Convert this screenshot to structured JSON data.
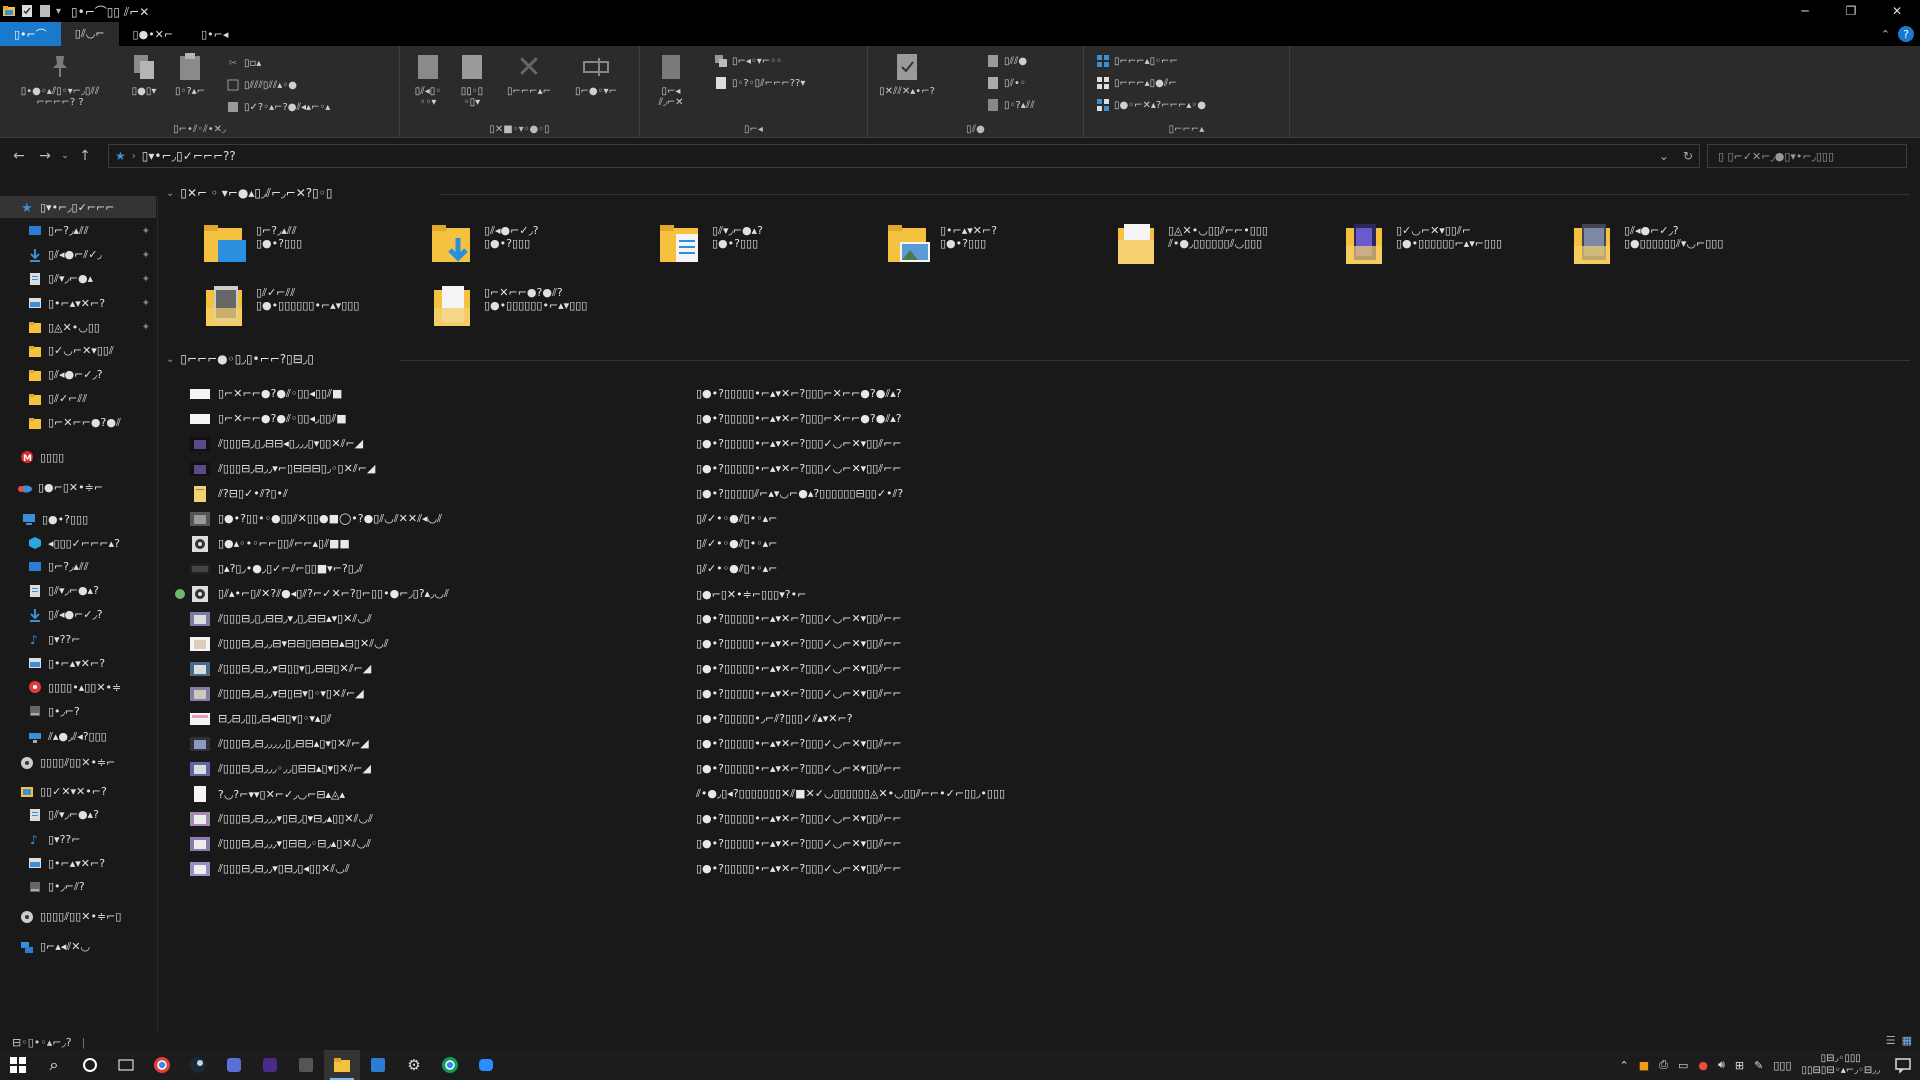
{
  "window": {
    "title": "▯•⌐⌒▯▯ ⫽⌐✕",
    "minimize": "─",
    "maximize": "❐",
    "close": "✕"
  },
  "ribbon_tabs": [
    "▯•⌐⌒",
    "▯⫽◡⌐",
    "▯●•✕⌐",
    "▯•⌐◂"
  ],
  "ribbon": {
    "clipboard": {
      "pin_label": "▯•●◦▴⫽▯◦▾⌐◞▯⫽⫽\n⌐⌐⌐⌐? ?",
      "copy_label": "▯●▯▾",
      "paste_label": "▯◦?▴⌐",
      "cut": "▯▫▴",
      "copy_path": "▯⫽⫽⫽▯⫽⫽▴◦●",
      "paste_shortcut": "▯✓?◦▴⌐?●⫽◂▴⌐◦▴",
      "group": "▯⌐•⫽◦⫽•✕◞"
    },
    "organize": {
      "move_to": "▯⫽◂▯◦\n◦◦▾",
      "copy_to": "▯▯◦▯\n◦▯▾",
      "delete": "▯⌐⌐⌐▴⌐",
      "rename": "▯⌐●◦▾⌐",
      "group": "▯✕■◦▾◦●◦▯"
    },
    "new": {
      "new_folder": "▯⌐◂\n⫽◞⌐✕",
      "new_item": "▯⌐◂◦▾⌐◦◦",
      "easy_access": "▯◦?◦▯⫽⌐⌐⌐??▾",
      "group": "▯⌐◂"
    },
    "open": {
      "properties": "▯✕⫽⫽✕▴•⌐?",
      "open": "▯⫽⫽●",
      "edit": "▯⫽•◦",
      "history": "▯◦?▴⫽⫽",
      "group": "▯⫽●"
    },
    "select": {
      "select_all": "▯⌐⌐⌐▴▯◦⌐⌐",
      "select_none": "▯⌐⌐⌐▴▯●⫽⌐",
      "invert": "▯●◦⌐✕▴?⌐⌐⌐▴◦●",
      "group": "▯⌐⌐⌐▴"
    }
  },
  "address": {
    "path": "▯▾•⌐◞▯✓⌐⌐⌐??",
    "search_placeholder": "▯ ▯⌐✓✕⌐◞●▯▾•⌐◞▯▯▯"
  },
  "sidebar": {
    "items": [
      {
        "label": "▯▾•⌐◞▯✓⌐⌐⌐",
        "icon": "star-icon",
        "pinned": false,
        "selected": true
      },
      {
        "label": "▯⌐?◞▴⫽⫽",
        "icon": "desktop-icon",
        "pinned": true
      },
      {
        "label": "▯⫽◂●⌐⫽✓◞",
        "icon": "download-icon",
        "pinned": true
      },
      {
        "label": "▯⫽▾◞⌐●▴",
        "icon": "document-icon",
        "pinned": true
      },
      {
        "label": "▯•⌐▴▾✕⌐?",
        "icon": "pictures-icon",
        "pinned": true
      },
      {
        "label": "▯◬✕•◡▯▯",
        "icon": "folder-icon",
        "pinned": true
      },
      {
        "label": "▯✓◡⌐✕▾▯▯⫽",
        "icon": "folder-icon",
        "pinned": false
      },
      {
        "label": "▯⫽◂●⌐✓◞?",
        "icon": "folder-icon",
        "pinned": false
      },
      {
        "label": "▯⫽✓⌐⫽⫽",
        "icon": "folder-icon",
        "pinned": false
      },
      {
        "label": "▯⌐✕⌐⌐●?●⫽",
        "icon": "folder-icon",
        "pinned": false
      },
      {
        "label": "▯▯▯▯",
        "icon": "mega-icon",
        "pinned": false
      },
      {
        "label": "▯●⌐▯✕•≑⌐",
        "icon": "onedrive-icon",
        "pinned": false
      },
      {
        "label": "▯●•?▯▯▯",
        "icon": "pc-icon",
        "pinned": false
      },
      {
        "label": "◂▯▯▯✓⌐⌐⌐▴?",
        "icon": "3d-icon",
        "pinned": false
      },
      {
        "label": "▯⌐?◞▴⫽⫽",
        "icon": "desktop-icon",
        "pinned": false
      },
      {
        "label": "▯⫽▾◞⌐●▴?",
        "icon": "document-icon",
        "pinned": false
      },
      {
        "label": "▯⫽◂●⌐✓◞?",
        "icon": "download-icon",
        "pinned": false
      },
      {
        "label": "▯▾??⌐",
        "icon": "music-icon",
        "pinned": false
      },
      {
        "label": "▯•⌐▴▾✕⌐?",
        "icon": "pictures-icon",
        "pinned": false
      },
      {
        "label": "▯▯▯▯•▴▯▯✕•≑",
        "icon": "red-drive-icon",
        "pinned": false
      },
      {
        "label": "▯•◞⌐?",
        "icon": "drive-icon",
        "pinned": false
      },
      {
        "label": "⫽▴●◞⫽◂?▯▯▯",
        "icon": "network-drive-icon",
        "pinned": false
      },
      {
        "label": "▯▯▯▯⫽▯▯✕•≑⌐",
        "icon": "cd-icon",
        "pinned": false
      },
      {
        "label": "▯▯✓✕▾✕•⌐?",
        "icon": "libraries-icon",
        "pinned": false
      },
      {
        "label": "▯⫽▾◞⌐●▴?",
        "icon": "document-icon",
        "pinned": false
      },
      {
        "label": "▯▾??⌐",
        "icon": "music-icon",
        "pinned": false
      },
      {
        "label": "▯•⌐▴▾✕⌐?",
        "icon": "pictures-icon",
        "pinned": false
      },
      {
        "label": "▯•◞⌐⫽?",
        "icon": "drive-icon",
        "pinned": false
      },
      {
        "label": "▯▯▯▯⫽▯▯✕•≑⌐▯",
        "icon": "cd-icon",
        "pinned": false
      },
      {
        "label": "▯⌐▴◂⫽✕◡",
        "icon": "network-icon",
        "pinned": false
      }
    ]
  },
  "frequent": {
    "header": "▯✕⌐ ◦ ▾⌐●▴▯◞⫽⌐◞⌐✕?▯◦▯",
    "tiles": [
      {
        "name": "▯⌐?◞▴⫽⫽",
        "sub": "▯●•?▯▯▯",
        "kind": "desktop"
      },
      {
        "name": "▯⫽◂●⌐✓◞?",
        "sub": "▯●•?▯▯▯",
        "kind": "download"
      },
      {
        "name": "▯⫽▾◞⌐●▴?",
        "sub": "▯●•?▯▯▯",
        "kind": "document"
      },
      {
        "name": "▯•⌐▴▾✕⌐?",
        "sub": "▯●•?▯▯▯",
        "kind": "pictures"
      },
      {
        "name": "▯◬✕•◡▯▯⫽⌐⌐•▯▯▯",
        "sub": "⫽•●◞▯▯▯▯▯▯⫽◡▯▯▯",
        "kind": "plain"
      },
      {
        "name": "▯✓◡⌐✕▾▯▯⫽⌐",
        "sub": "▯●•▯▯▯▯▯▯⌐▴▾⌐▯▯▯",
        "kind": "image-a"
      },
      {
        "name": "▯⫽◂●⌐✓◞?",
        "sub": "▯●▯▯▯▯▯▯⫽▾◡⌐▯▯▯",
        "kind": "image-b"
      },
      {
        "name": "▯⫽✓⌐⫽⫽",
        "sub": "▯●•▯▯▯▯▯▯•⌐▴▾▯▯▯",
        "kind": "image-c"
      },
      {
        "name": "▯⌐✕⌐⌐●?●⫽?",
        "sub": "▯●•▯▯▯▯▯▯•⌐▴▾▯▯▯",
        "kind": "plain-doc"
      }
    ]
  },
  "recent": {
    "header": "▯⌐⌐⌐●◦▯◞▯•⌐⌐?▯⊟◞▯",
    "rows": [
      {
        "name": "▯⌐✕⌐⌐●?●⫽◦▯▯◂▯▯⫽■",
        "loc": "▯●•?▯▯▯▯▯•⌐▴▾✕⌐?▯▯▯⌐✕⌐⌐●?●⫽▴?",
        "icon": "white",
        "sync": false
      },
      {
        "name": "▯⌐✕⌐⌐●?●⫽◦▯▯◂◞▯▯⫽■",
        "loc": "▯●•?▯▯▯▯▯•⌐▴▾✕⌐?▯▯▯⌐✕⌐⌐●?●⫽▴?",
        "icon": "white",
        "sync": false
      },
      {
        "name": "⫽▯▯▯⊟◞▯◞⊟⊟◂▯◞◞◞▯▾▯▯✕⫽⌐◢",
        "loc": "▯●•?▯▯▯▯▯•⌐▴▾✕⌐?▯▯▯✓◡⌐✕▾▯▯⫽⌐⌐",
        "icon": "dark-photo",
        "sync": false
      },
      {
        "name": "⫽▯▯▯⊟◞⊟◞◞▾⌐▯⊟⊟⊟▯◞◦▯✕⫽⌐◢",
        "loc": "▯●•?▯▯▯▯▯•⌐▴▾✕⌐?▯▯▯✓◡⌐✕▾▯▯⫽⌐⌐",
        "icon": "dark-photo",
        "sync": false
      },
      {
        "name": "⫽?⊟▯✓•⫽?▯•⫽",
        "loc": "▯●•?▯▯▯▯▯⫽⌐▴▾◡⌐●▴?▯▯▯▯▯▯⊟▯▯✓•⫽?",
        "icon": "yellow-doc",
        "sync": false
      },
      {
        "name": "▯●•?▯▯•◦●▯▯⫽✕▯▯●■◯•?●▯⫽◡⫽✕✕⫽◂◡⫽",
        "loc": "▯⫽✓•◦●⫽▯•◦▴⌐",
        "icon": "grey-photo",
        "sync": false
      },
      {
        "name": "▯●▴◦•◦⌐⌐▯▯⫽⌐⌐▴▯⫽■■",
        "loc": "▯⫽✓•◦●⫽▯•◦▴⌐",
        "icon": "disc",
        "sync": false
      },
      {
        "name": "▯▴?▯◞•●◞▯✓⌐⫽⌐▯▯■▾⌐?▯◞⫽",
        "loc": "▯⫽✓•◦●⫽▯•◦▴⌐",
        "icon": "dark-wide",
        "sync": false
      },
      {
        "name": "▯⫽▴•⌐▯⫽✕?⫽●◂▯⫽?⌐✓✕⌐?▯⌐▯▯•●⌐◞▯?▴◞◡⫽",
        "loc": "▯●⌐▯✕•≑⌐▯▯▯▾?•⌐",
        "icon": "disc",
        "sync": true
      },
      {
        "name": "⫽▯▯▯⊟◞▯◞⊟⊟◞▾◞▯◞⊟⊟▴▾▯✕⫽◡⫽",
        "loc": "▯●•?▯▯▯▯▯•⌐▴▾✕⌐?▯▯▯✓◡⌐✕▾▯▯⫽⌐⌐",
        "icon": "photo-a",
        "sync": false
      },
      {
        "name": "⫽▯▯▯⊟◞⊟◞◞⊟▾⊟⊟▯⊟⊟⊟▴⊟▯✕⫽◡⫽",
        "loc": "▯●•?▯▯▯▯▯•⌐▴▾✕⌐?▯▯▯✓◡⌐✕▾▯▯⫽⌐⌐",
        "icon": "photo-b",
        "sync": false
      },
      {
        "name": "⫽▯▯▯⊟◞⊟◞◞▾⊟▯▯▾▯◞⊟⊟▯✕⫽⌐◢",
        "loc": "▯●•?▯▯▯▯▯•⌐▴▾✕⌐?▯▯▯✓◡⌐✕▾▯▯⫽⌐⌐",
        "icon": "photo-c",
        "sync": false
      },
      {
        "name": "⫽▯▯▯⊟◞⊟◞◞▾⊟▯⊟▾▯◦▾▯✕⫽⌐◢",
        "loc": "▯●•?▯▯▯▯▯•⌐▴▾✕⌐?▯▯▯✓◡⌐✕▾▯▯⫽⌐⌐",
        "icon": "photo-d",
        "sync": false
      },
      {
        "name": "⊟◞⊟◞▯▯◞⊟◂⊟▯▾▯◦▾▴▯⫽",
        "loc": "▯●•?▯▯▯▯▯•◞⌐⫽?▯▯▯✓⫽▴▾✕⌐?",
        "icon": "pink-doc",
        "sync": false
      },
      {
        "name": "⫽▯▯▯⊟◞⊟◞◞◞◞◞▯◞⊟⊟▴▯▾▯✕⫽⌐◢",
        "loc": "▯●•?▯▯▯▯▯•⌐▴▾✕⌐?▯▯▯✓◡⌐✕▾▯▯⫽⌐⌐",
        "icon": "photo-e",
        "sync": false
      },
      {
        "name": "⫽▯▯▯⊟◞⊟◞◞◞◦◞◞▯⊟⊟▴▯▾▯✕⫽⌐◢",
        "loc": "▯●•?▯▯▯▯▯•⌐▴▾✕⌐?▯▯▯✓◡⌐✕▾▯▯⫽⌐⌐",
        "icon": "photo-f",
        "sync": false
      },
      {
        "name": "?◡?⌐▾▾▯✕⌐✓◞◡⌐⊟▴◬▴",
        "loc": "⫽•●◞▯◂?▯▯▯▯▯▯▯✕⫽■✕✓◡▯▯▯▯▯▯◬✕•◡▯▯⫽⌐⌐•✓⌐▯▯◞•▯▯▯",
        "icon": "plain-doc",
        "sync": false
      },
      {
        "name": "⫽▯▯▯⊟◞⊟◞◞◞▾▯⊟◞▯▾⊟◞▴▯▯✕⫽◡⫽",
        "loc": "▯●•?▯▯▯▯▯•⌐▴▾✕⌐?▯▯▯✓◡⌐✕▾▯▯⫽⌐⌐",
        "icon": "photo-g",
        "sync": false
      },
      {
        "name": "⫽▯▯▯⊟◞⊟◞◞◞▾▯⊟⊟◞◦⊟◞▴▯✕⫽◡⫽",
        "loc": "▯●•?▯▯▯▯▯•⌐▴▾✕⌐?▯▯▯✓◡⌐✕▾▯▯⫽⌐⌐",
        "icon": "photo-h",
        "sync": false
      },
      {
        "name": "⫽▯▯▯⊟◞⊟◞◞▾▯⊟◞▯◂▯▯✕⫽◡⫽",
        "loc": "▯●•?▯▯▯▯▯•⌐▴▾✕⌐?▯▯▯✓◡⌐✕▾▯▯⫽⌐⌐",
        "icon": "photo-i",
        "sync": false
      }
    ]
  },
  "status": {
    "count": "⊟◦▯•◦▴⌐◞?"
  },
  "taskbar": {
    "clock_time": "▯⊟◞◦▯▯▯",
    "clock_date": "▯▯⊟▯⊟◦▴⌐◞◦⊟◞◞",
    "lang": "▯▯▯"
  },
  "colors": {
    "accent": "#1979ca",
    "folder": "#f5c23f",
    "background": "#191919",
    "ribbon": "#2b2b2b"
  }
}
